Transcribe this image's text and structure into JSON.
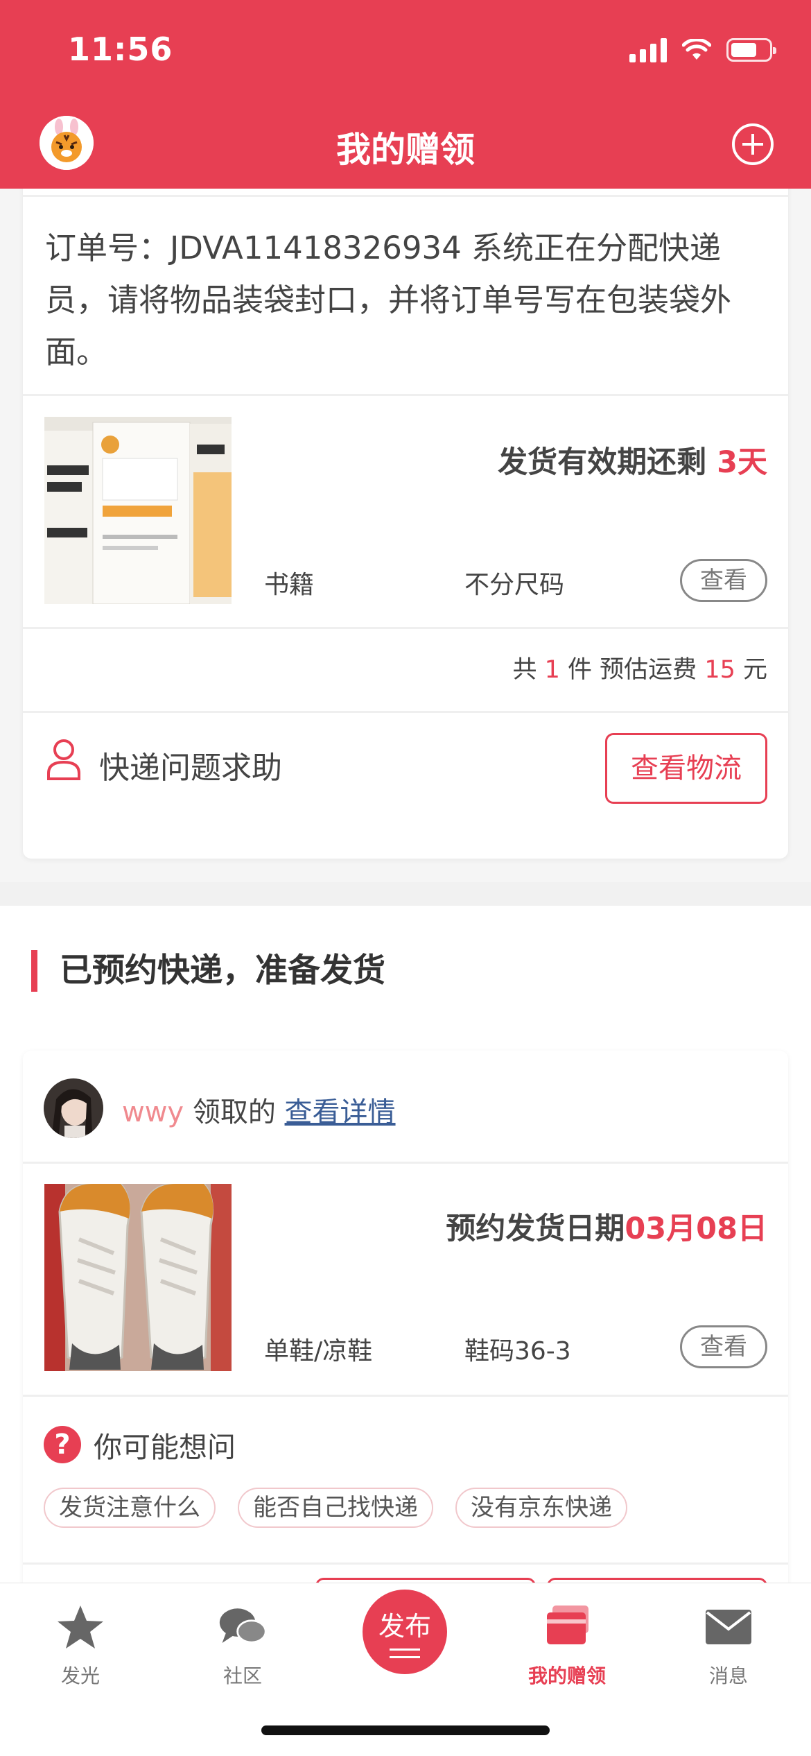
{
  "status_bar": {
    "time": "11:56"
  },
  "header": {
    "title": "我的赠领"
  },
  "card1": {
    "order_text": "订单号：JDVA11418326934 系统正在分配快递员，请将物品装袋封口，并将订单号写在包装袋外面。",
    "deadline_label": "发货有效期还剩 ",
    "deadline_value": "3天",
    "category": "书籍",
    "size": "不分尺码",
    "view_label": "查看",
    "summary": {
      "prefix": "共 ",
      "count": "1",
      "mid": " 件 预估运费 ",
      "fee": "15",
      "suffix": " 元"
    },
    "help_label": "快递问题求助",
    "logistics_label": "查看物流"
  },
  "section2": {
    "title": "已预约快递，准备发货"
  },
  "card2": {
    "user_name": "wwy",
    "received_text": " 领取的 ",
    "detail_link": "查看详情",
    "ship_date_label": "预约发货日期",
    "ship_date_value": "03月08日",
    "category": "单鞋/凉鞋",
    "size": "鞋码36-3",
    "view_label": "查看",
    "ask_label": "你可能想问",
    "chips": [
      "发货注意什么",
      "能否自己找快递",
      "没有京东快递"
    ]
  },
  "tabbar": {
    "items": [
      {
        "label": "发光",
        "icon": "star-icon"
      },
      {
        "label": "社区",
        "icon": "chat-icon"
      },
      {
        "label": "发布",
        "icon": "publish-icon"
      },
      {
        "label": "我的赠领",
        "icon": "gift-cards-icon"
      },
      {
        "label": "消息",
        "icon": "mail-icon"
      }
    ]
  },
  "colors": {
    "brand": "#e73f53",
    "link": "#3a5d96",
    "username": "#f08a8f"
  }
}
